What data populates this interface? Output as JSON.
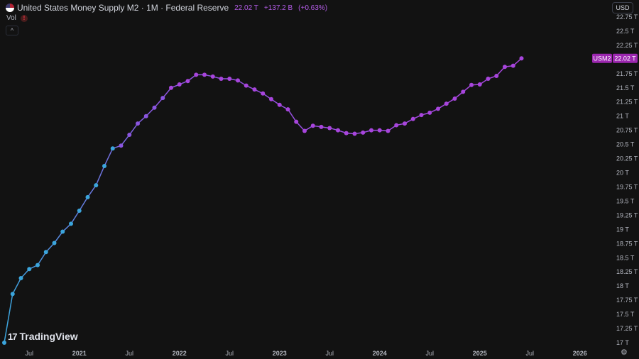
{
  "legend": {
    "title": "United States Money Supply M2 · 1M · Federal Reserve",
    "last_value": "22.02 T",
    "change": "+137.2 B",
    "change_pct": "(+0.63%)",
    "vol_label": "Vol",
    "warn_symbol": "!",
    "collapse_symbol": "^"
  },
  "toolbar": {
    "currency": "USD",
    "settings_icon": "gear-icon"
  },
  "branding": {
    "logo_mark": "17",
    "logo_text": "TradingView"
  },
  "colors": {
    "background": "#121212",
    "line_start": "#3ba5dc",
    "line_end": "#a845dd",
    "label_bg": "#9c27b0",
    "axis_text": "#b2b5be"
  },
  "chart_data": {
    "type": "line",
    "series": [
      {
        "name": "USM2",
        "x": [
          "2020-04",
          "2020-05",
          "2020-06",
          "2020-07",
          "2020-08",
          "2020-09",
          "2020-10",
          "2020-11",
          "2020-12",
          "2021-01",
          "2021-02",
          "2021-03",
          "2021-04",
          "2021-05",
          "2021-06",
          "2021-07",
          "2021-08",
          "2021-09",
          "2021-10",
          "2021-11",
          "2021-12",
          "2022-01",
          "2022-02",
          "2022-03",
          "2022-04",
          "2022-05",
          "2022-06",
          "2022-07",
          "2022-08",
          "2022-09",
          "2022-10",
          "2022-11",
          "2022-12",
          "2023-01",
          "2023-02",
          "2023-03",
          "2023-04",
          "2023-05",
          "2023-06",
          "2023-07",
          "2023-08",
          "2023-09",
          "2023-10",
          "2023-11",
          "2023-12",
          "2024-01",
          "2024-02",
          "2024-03",
          "2024-04",
          "2024-05",
          "2024-06",
          "2024-07",
          "2024-08",
          "2024-09",
          "2024-10",
          "2024-11",
          "2024-12",
          "2025-01",
          "2025-02",
          "2025-03",
          "2025-04",
          "2025-05",
          "2025-06"
        ],
        "values": [
          17.0,
          17.86,
          18.14,
          18.3,
          18.37,
          18.6,
          18.76,
          18.96,
          19.1,
          19.33,
          19.57,
          19.78,
          20.12,
          20.43,
          20.48,
          20.67,
          20.87,
          21.0,
          21.15,
          21.32,
          21.5,
          21.56,
          21.62,
          21.73,
          21.73,
          21.7,
          21.66,
          21.66,
          21.63,
          21.54,
          21.47,
          21.4,
          21.3,
          21.2,
          21.12,
          20.9,
          20.74,
          20.83,
          20.81,
          20.79,
          20.75,
          20.7,
          20.69,
          20.71,
          20.75,
          20.75,
          20.74,
          20.84,
          20.87,
          20.95,
          21.02,
          21.06,
          21.13,
          21.22,
          21.31,
          21.43,
          21.55,
          21.56,
          21.66,
          21.71,
          21.87,
          21.89,
          22.02
        ]
      }
    ],
    "ylim": [
      17.0,
      22.75
    ],
    "yticks": [
      17.0,
      17.25,
      17.5,
      17.75,
      18.0,
      18.25,
      18.5,
      18.75,
      19.0,
      19.25,
      19.5,
      19.75,
      20.0,
      20.25,
      20.5,
      20.75,
      21.0,
      21.25,
      21.5,
      21.75,
      22.0,
      22.25,
      22.5,
      22.75
    ],
    "ytick_labels": [
      "17 T",
      "17.25 T",
      "17.5 T",
      "17.75 T",
      "18 T",
      "18.25 T",
      "18.5 T",
      "18.75 T",
      "19 T",
      "19.25 T",
      "19.5 T",
      "19.75 T",
      "20 T",
      "20.25 T",
      "20.5 T",
      "20.75 T",
      "21 T",
      "21.25 T",
      "21.5 T",
      "21.75 T",
      "22 T",
      "22.25 T",
      "22.5 T",
      "22.75 T"
    ],
    "xticks": [
      {
        "x": "2020-07",
        "label": "Jul",
        "bold": false
      },
      {
        "x": "2021-01",
        "label": "2021",
        "bold": true
      },
      {
        "x": "2021-07",
        "label": "Jul",
        "bold": false
      },
      {
        "x": "2022-01",
        "label": "2022",
        "bold": true
      },
      {
        "x": "2022-07",
        "label": "Jul",
        "bold": false
      },
      {
        "x": "2023-01",
        "label": "2023",
        "bold": true
      },
      {
        "x": "2023-07",
        "label": "Jul",
        "bold": false
      },
      {
        "x": "2024-01",
        "label": "2024",
        "bold": true
      },
      {
        "x": "2024-07",
        "label": "Jul",
        "bold": false
      },
      {
        "x": "2025-01",
        "label": "2025",
        "bold": true
      },
      {
        "x": "2025-07",
        "label": "Jul",
        "bold": false
      },
      {
        "x": "2026-01",
        "label": "2026",
        "bold": true
      }
    ],
    "last_label": {
      "name": "USM2",
      "value": "22.02 T"
    },
    "grid": false,
    "legend": "top-left"
  }
}
